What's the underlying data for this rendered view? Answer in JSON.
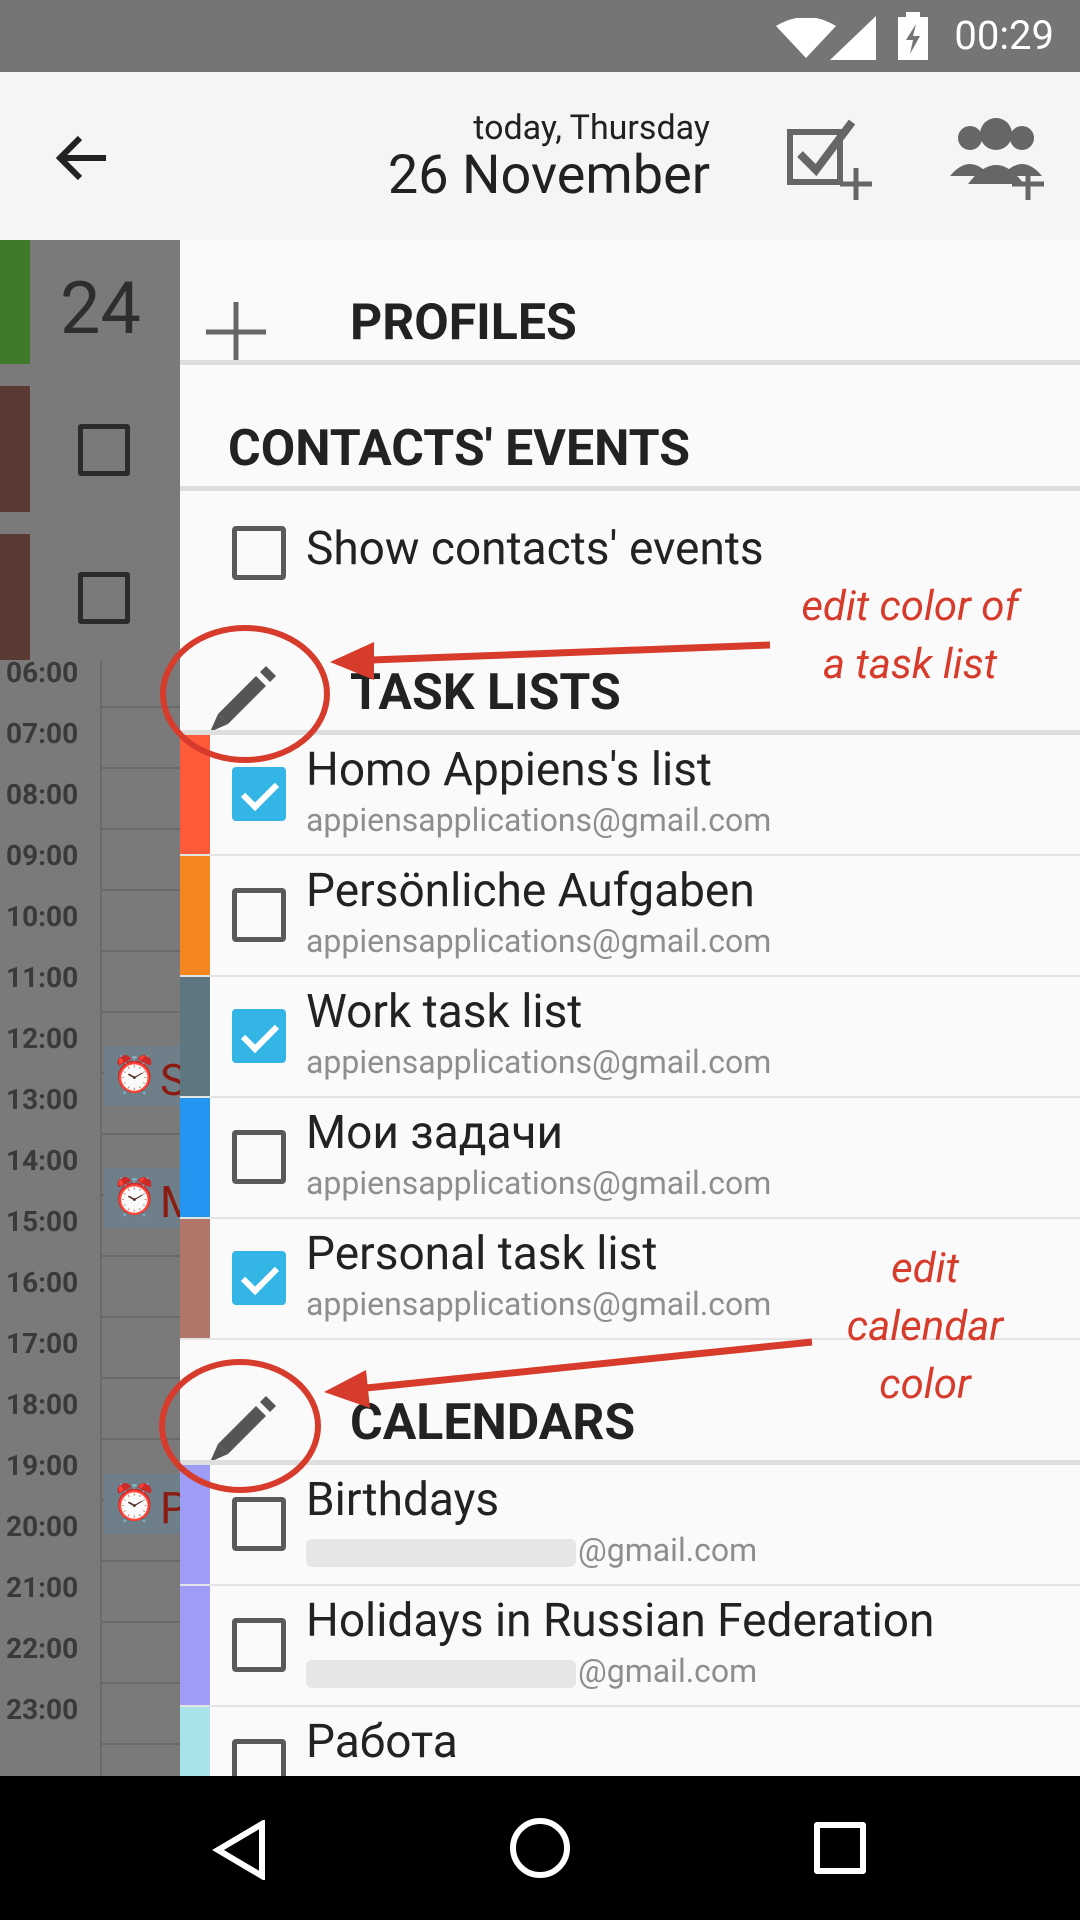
{
  "status_bar": {
    "time": "00:29",
    "wifi_icon": "wifi-icon",
    "signal_icon": "signal-icon",
    "battery_icon": "battery-charging-icon"
  },
  "app_bar": {
    "date_small": "today, Thursday",
    "date_big": "26 November"
  },
  "background_calendar": {
    "day_number": "24",
    "hours": [
      "06:00",
      "07:00",
      "08:00",
      "09:00",
      "10:00",
      "11:00",
      "12:00",
      "13:00",
      "14:00",
      "15:00",
      "16:00",
      "17:00",
      "18:00",
      "19:00",
      "20:00",
      "21:00",
      "22:00",
      "23:00"
    ],
    "events": [
      {
        "letter": "S"
      },
      {
        "letter": "M"
      },
      {
        "letter": "P"
      }
    ]
  },
  "drawer": {
    "profiles_header": "PROFILES",
    "contacts_header": "CONTACTS' EVENTS",
    "show_contacts_label": "Show contacts' events",
    "task_lists_header": "TASK LISTS",
    "task_lists": [
      {
        "title": "Homo Appiens's list",
        "account": "appiensapplications@gmail.com",
        "checked": true,
        "color": "#ff5a3a"
      },
      {
        "title": "Persönliche Aufgaben",
        "account": "appiensapplications@gmail.com",
        "checked": false,
        "color": "#f5861f"
      },
      {
        "title": "Work task list",
        "account": "appiensapplications@gmail.com",
        "checked": true,
        "color": "#5e7680"
      },
      {
        "title": "Мои задачи",
        "account": "appiensapplications@gmail.com",
        "checked": false,
        "color": "#2595f2"
      },
      {
        "title": "Personal task list",
        "account": "appiensapplications@gmail.com",
        "checked": true,
        "color": "#b0766a"
      }
    ],
    "calendars_header": "CALENDARS",
    "calendars": [
      {
        "title": "Birthdays",
        "account_suffix": "@gmail.com",
        "checked": false,
        "color": "#9e9cf5"
      },
      {
        "title": "Holidays in Russian Federation",
        "account_suffix": "@gmail.com",
        "checked": false,
        "color": "#9e9cf5"
      },
      {
        "title": "Работа",
        "account_suffix": "",
        "checked": false,
        "color": "#a8e3ea"
      }
    ]
  },
  "annotations": {
    "task_color_line1": "edit color of",
    "task_color_line2": "a task list",
    "cal_color_line1": "edit",
    "cal_color_line2": "calendar",
    "cal_color_line3": "color",
    "color": "#d63b2b"
  }
}
